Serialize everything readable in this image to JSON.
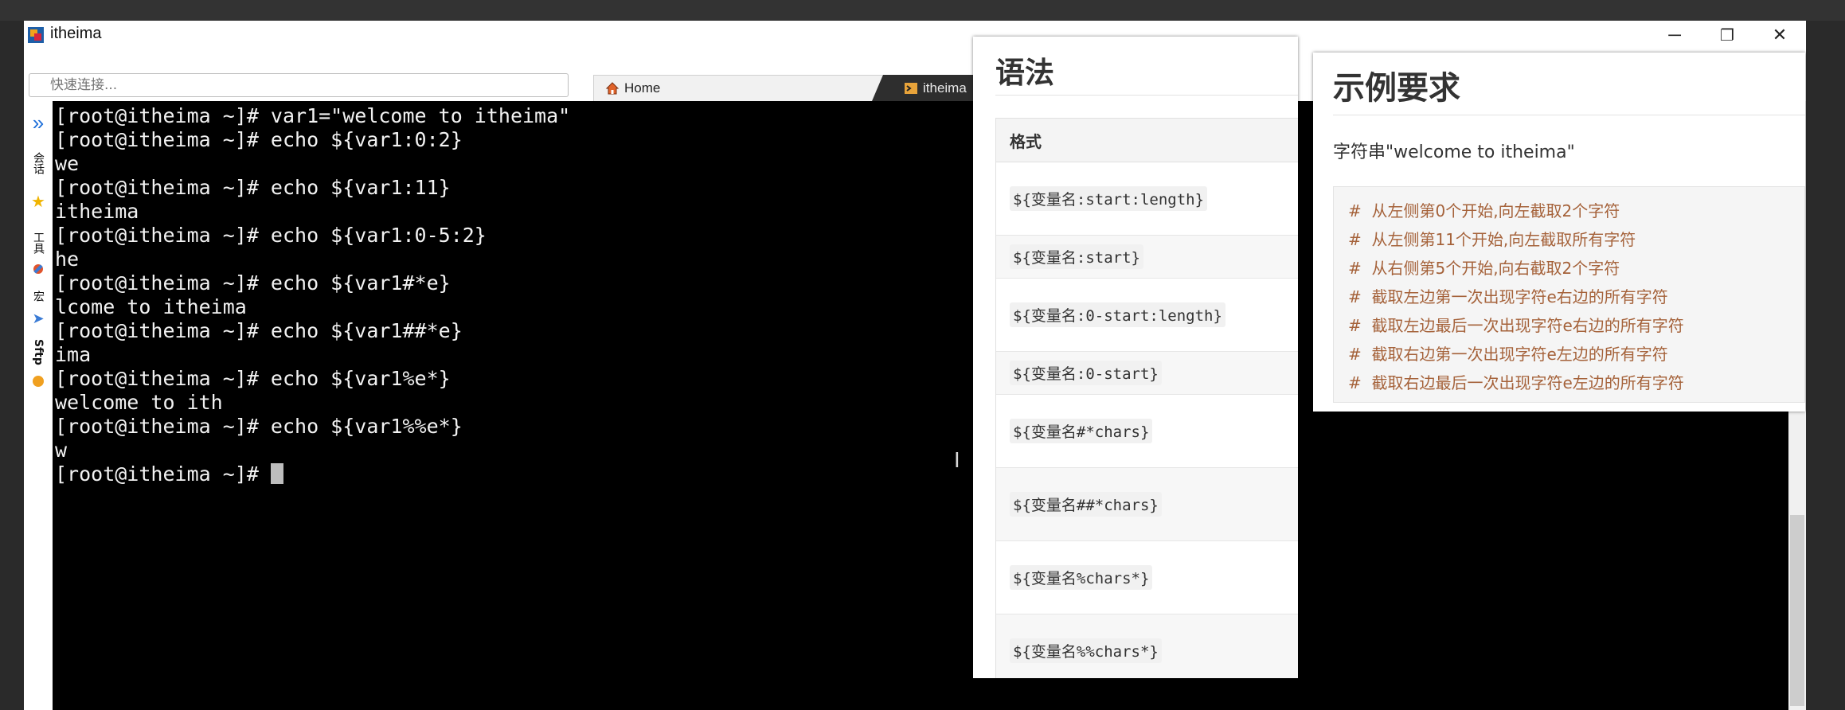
{
  "window": {
    "title": "itheima",
    "controls": {
      "minimize": "─",
      "restore": "❐",
      "close": "✕"
    }
  },
  "toolbar": {
    "quick_connect_placeholder": "快速连接...",
    "tabs": [
      {
        "label": "Home",
        "active": false
      },
      {
        "label": "itheima",
        "active": true
      }
    ]
  },
  "sidebar": {
    "items": [
      {
        "label": "会话"
      },
      {
        "label": "工具"
      },
      {
        "label": "宏"
      },
      {
        "label": "Sftp"
      }
    ]
  },
  "terminal": {
    "lines": [
      "[root@itheima ~]# var1=\"welcome to itheima\"",
      "[root@itheima ~]# echo ${var1:0:2}",
      "we",
      "[root@itheima ~]# echo ${var1:11}",
      "itheima",
      "[root@itheima ~]# echo ${var1:0-5:2}",
      "he",
      "[root@itheima ~]# echo ${var1#*e}",
      "lcome to itheima",
      "[root@itheima ~]# echo ${var1##*e}",
      "ima",
      "[root@itheima ~]# echo ${var1%e*}",
      "welcome to ith",
      "[root@itheima ~]# echo ${var1%%e*}",
      "w"
    ],
    "prompt": "[root@itheima ~]# "
  },
  "syntax_panel": {
    "title": "语法",
    "header": "格式",
    "rows": [
      "${变量名:start:length}",
      "${变量名:start}",
      "${变量名:0-start:length}",
      "${变量名:0-start}",
      "${变量名#*chars}",
      "${变量名##*chars}",
      "${变量名%chars*}",
      "${变量名%%chars*}"
    ]
  },
  "example_panel": {
    "title": "示例要求",
    "text": "字符串\"welcome to itheima\"",
    "comments": [
      "#  从左侧第0个开始,向左截取2个字符",
      "#  从左侧第11个开始,向左截取所有字符",
      "#  从右侧第5个开始,向右截取2个字符",
      "#  截取左边第一次出现字符e右边的所有字符",
      "#  截取左边最后一次出现字符e右边的所有字符",
      "#  截取右边第一次出现字符e左边的所有字符",
      "#  截取右边最后一次出现字符e左边的所有字符"
    ]
  },
  "colors": {
    "terminal_bg": "#000000",
    "terminal_fg": "#f2f2f2",
    "comment": "#a5623a"
  }
}
